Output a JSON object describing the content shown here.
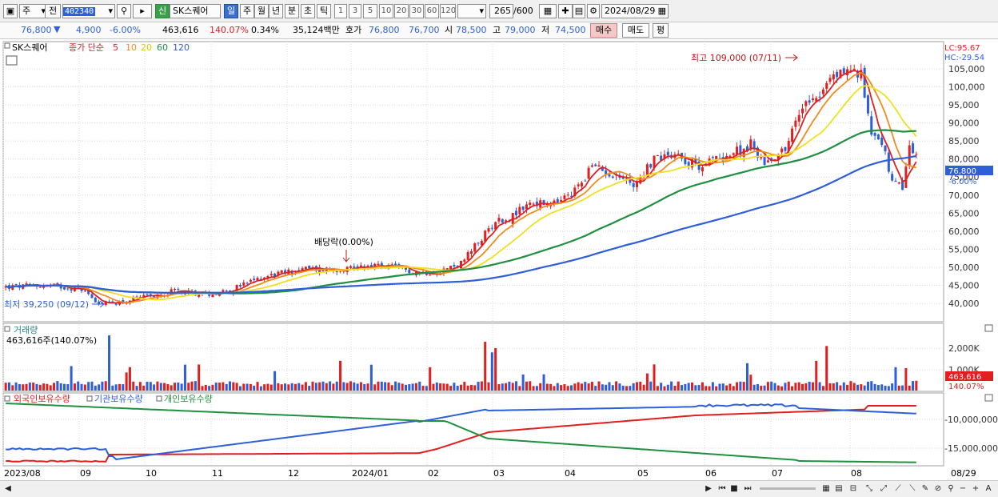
{
  "toolbar": {
    "market": "주",
    "prev": "전",
    "code": "402340",
    "new_badge": "신",
    "stock_name": "SK스퀘어",
    "periods": [
      "일",
      "주",
      "월",
      "년",
      "분",
      "초",
      "틱"
    ],
    "selected_period": "일",
    "intervals": [
      "1",
      "3",
      "5",
      "10",
      "20",
      "30",
      "60",
      "120"
    ],
    "count": "265",
    "count_total": "/600",
    "date": "2024/08/29"
  },
  "quote": {
    "price": "76,800",
    "change": "4,900",
    "change_pct": "-6.00%",
    "volume": "463,616",
    "volume_ratio": "140.07%",
    "turnover": "0.34%",
    "amount": "35,124백만",
    "bid_label": "호가",
    "ask": "76,800",
    "bid": "76,700",
    "open_label": "시",
    "open": "78,500",
    "high_label": "고",
    "high": "79,000",
    "low_label": "저",
    "low": "74,500",
    "buy_button": "매수",
    "sell_button": "매도",
    "eval_button": "평"
  },
  "price_panel": {
    "legend_name": "SK스퀘어",
    "legend_ma_prefix": "종가 단순",
    "ma_periods": [
      "5",
      "10",
      "20",
      "60",
      "120"
    ],
    "ma_colors": [
      "#e02020",
      "#f08c1e",
      "#f0e020",
      "#209040",
      "#2f5fd8"
    ],
    "lc": "LC:95.67",
    "hc": "HC:-29.54",
    "y_ticks": [
      "105,000",
      "100,000",
      "95,000",
      "90,000",
      "85,000",
      "80,000",
      "75,000",
      "70,000",
      "65,000",
      "60,000",
      "55,000",
      "50,000",
      "45,000",
      "40,000"
    ],
    "y_values": [
      105000,
      100000,
      95000,
      90000,
      85000,
      80000,
      75000,
      70000,
      65000,
      60000,
      55000,
      50000,
      45000,
      40000
    ],
    "y_range": [
      35000,
      110000
    ],
    "current_price": "76,800",
    "current_pct": "-6.00%",
    "high_note": "최고 109,000 (07/11)",
    "low_note": "최저 39,250 (09/12)",
    "dividend_note": "배당락(0.00%)"
  },
  "volume_panel": {
    "title": "거래량",
    "info": "463,616주(140.07%)",
    "y_ticks": [
      "2,000K",
      "1,000K"
    ],
    "y_values": [
      2000000,
      1000000
    ],
    "current": "463,616",
    "current_pct": "140.07%"
  },
  "holding_panel": {
    "series": [
      "외국인보유수량",
      "기관보유수량",
      "개인보유수량"
    ],
    "series_colors": [
      "#e02020",
      "#2f5fd8",
      "#209040"
    ],
    "y_ticks": [
      "-10,000,000",
      "-15,000,000"
    ],
    "y_values": [
      -10000000,
      -15000000
    ]
  },
  "x_axis": {
    "labels": [
      "2023/08",
      "09",
      "10",
      "11",
      "12",
      "2024/01",
      "02",
      "03",
      "04",
      "05",
      "06",
      "07",
      "08"
    ],
    "right_label": "08/29"
  },
  "chart_data": {
    "type": "candlestick",
    "price_series": [
      {
        "date": "2023/08",
        "close": 44500
      },
      {
        "date": "2023/09/12",
        "close": 39250
      },
      {
        "date": "2023/10",
        "close": 42000
      },
      {
        "date": "2023/11",
        "close": 44500
      },
      {
        "date": "2023/12",
        "close": 49500
      },
      {
        "date": "2024/01",
        "close": 48000
      },
      {
        "date": "2024/02",
        "close": 62000
      },
      {
        "date": "2024/03",
        "close": 68000
      },
      {
        "date": "2024/04",
        "close": 76000
      },
      {
        "date": "2024/05",
        "close": 80000
      },
      {
        "date": "2024/06",
        "close": 88000
      },
      {
        "date": "2024/07/11",
        "close": 105000
      },
      {
        "date": "2024/08",
        "close": 72000
      },
      {
        "date": "2024/08/29",
        "close": 76800
      }
    ],
    "ylim": [
      35000,
      110000
    ]
  }
}
